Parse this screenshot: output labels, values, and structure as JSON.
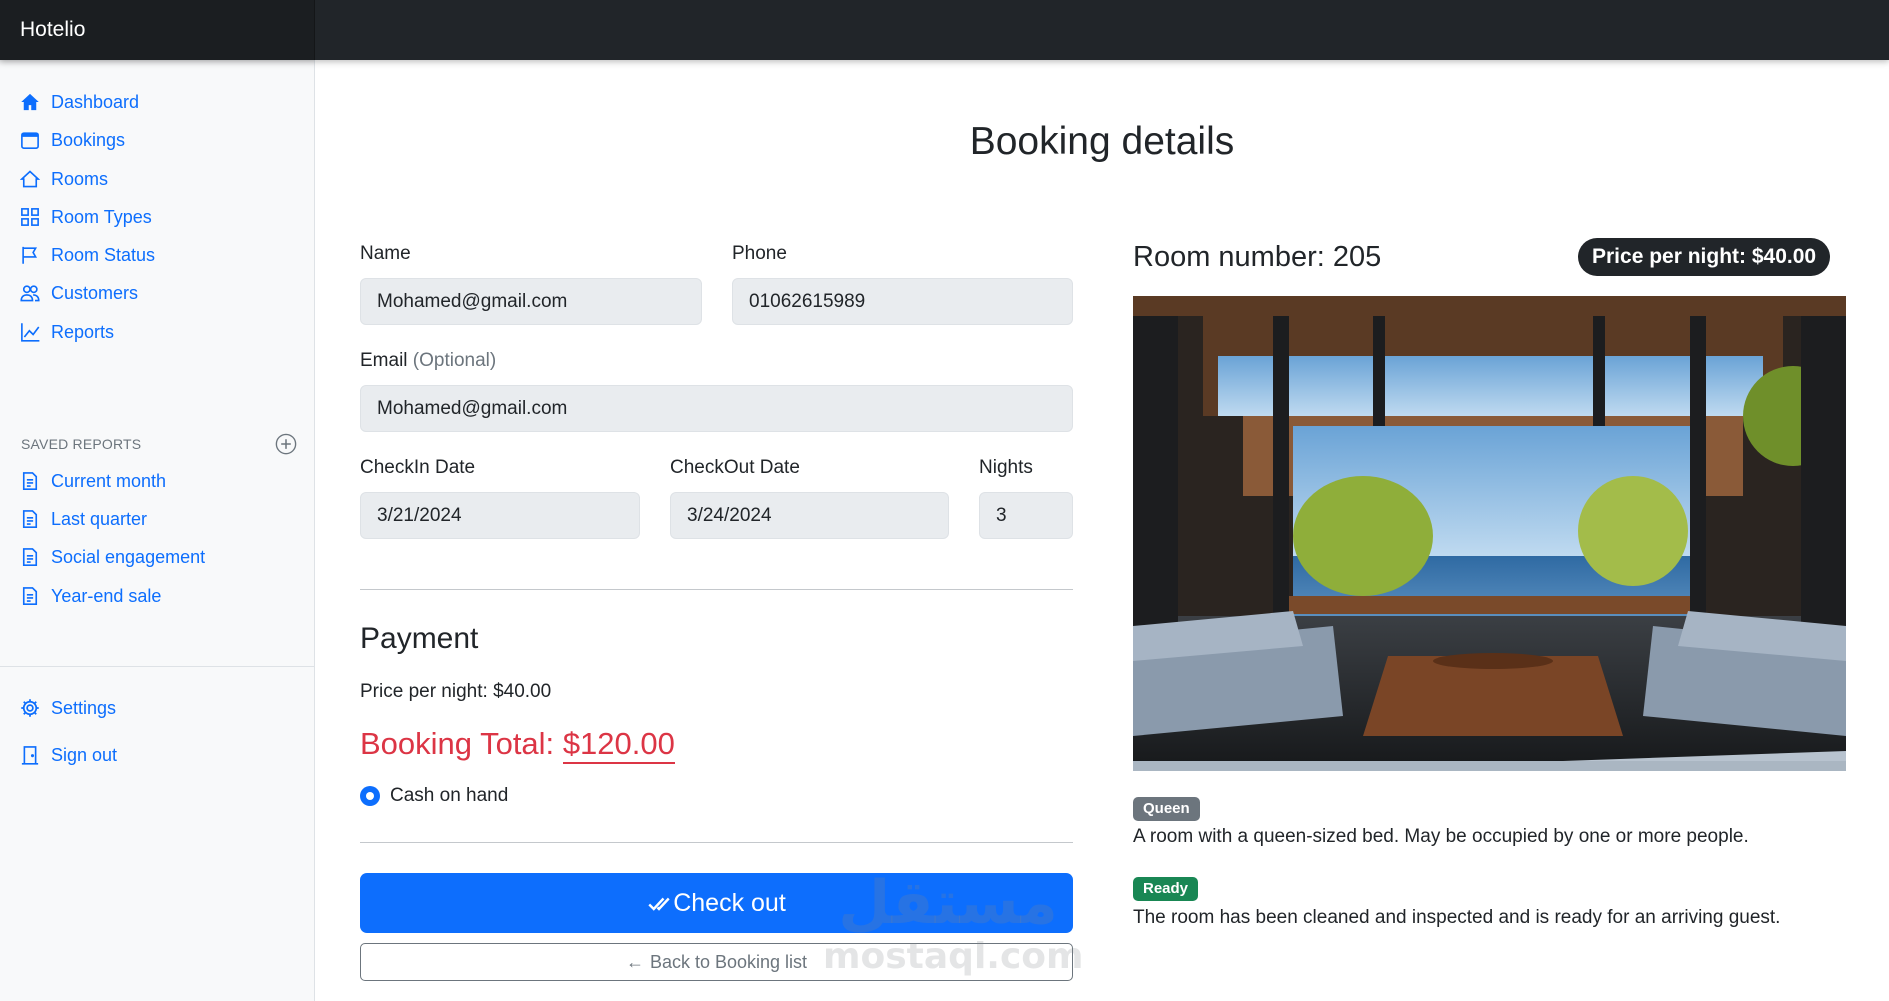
{
  "app": {
    "brand": "Hotelio"
  },
  "sidebar": {
    "items": [
      {
        "label": "Dashboard",
        "icon": "house-icon"
      },
      {
        "label": "Bookings",
        "icon": "calendar-icon"
      },
      {
        "label": "Rooms",
        "icon": "house-outline-icon"
      },
      {
        "label": "Room Types",
        "icon": "grid-icon"
      },
      {
        "label": "Room Status",
        "icon": "flag-icon"
      },
      {
        "label": "Customers",
        "icon": "people-icon"
      },
      {
        "label": "Reports",
        "icon": "graph-icon"
      }
    ],
    "saved_reports": {
      "heading": "SAVED REPORTS",
      "items": [
        {
          "label": "Current month",
          "icon": "file-text-icon"
        },
        {
          "label": "Last quarter",
          "icon": "file-text-icon"
        },
        {
          "label": "Social engagement",
          "icon": "file-text-icon"
        },
        {
          "label": "Year-end sale",
          "icon": "file-text-icon"
        }
      ]
    },
    "footer_items": [
      {
        "label": "Settings",
        "icon": "gear-icon"
      },
      {
        "label": "Sign out",
        "icon": "door-icon"
      }
    ]
  },
  "page": {
    "title": "Booking details"
  },
  "form": {
    "name": {
      "label": "Name",
      "value": "Mohamed@gmail.com"
    },
    "phone": {
      "label": "Phone",
      "value": "01062615989"
    },
    "email": {
      "label": "Email",
      "optional": "(Optional)",
      "value": "Mohamed@gmail.com"
    },
    "checkin": {
      "label": "CheckIn Date",
      "value": "3/21/2024"
    },
    "checkout": {
      "label": "CheckOut Date",
      "value": "3/24/2024"
    },
    "nights": {
      "label": "Nights",
      "value": "3"
    }
  },
  "payment": {
    "title": "Payment",
    "price_per_night_text": "Price per night: $40.00",
    "total_label": "Booking Total:",
    "total_value": "$120.00",
    "method": "Cash on hand",
    "checkout_button": "Check out",
    "back_button": "Back to Booking list"
  },
  "room": {
    "title": "Room number: 205",
    "price_badge": "Price per night: $40.00",
    "type_badge": "Queen",
    "type_description": "A room with a queen-sized bed. May be occupied by one or more people.",
    "status_badge": "Ready",
    "status_description": "The room has been cleaned and inspected and is ready for an arriving guest."
  },
  "watermark": {
    "line1": "مستقل",
    "line2": "mostaql.com"
  },
  "colors": {
    "primary": "#0d6efd",
    "danger": "#dc3545",
    "success": "#198754",
    "dark": "#212529",
    "secondary": "#6c757d"
  }
}
